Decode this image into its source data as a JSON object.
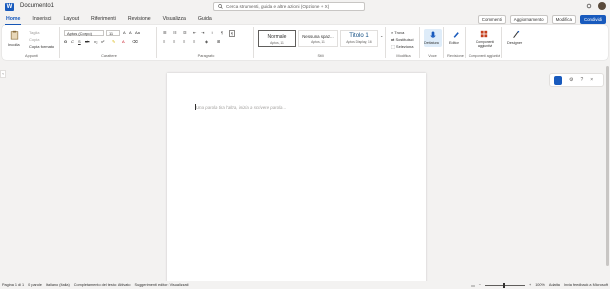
{
  "titlebar": {
    "app_logo_letter": "W",
    "doc_title": "Documento1",
    "search_placeholder": "Cerca strumenti, guida e altre azioni (Opzione + X)"
  },
  "menu": {
    "tabs": [
      "Home",
      "Inserisci",
      "Layout",
      "Riferimenti",
      "Revisione",
      "Visualizza",
      "Guida"
    ],
    "active_tab": "Home",
    "comments_label": "Commenti",
    "updates_label": "Aggiornamento",
    "edit_mode_label": "Modifica",
    "share_label": "Condividi"
  },
  "ribbon": {
    "clipboard": {
      "paste": "Incolla",
      "cut": "Taglia",
      "copy": "Copia",
      "format_painter": "Copia formato",
      "label": "Appunti"
    },
    "font": {
      "family": "Aptos (Corpo)",
      "size": "11",
      "label": "Carattere"
    },
    "paragraph": {
      "label": "Paragrafo"
    },
    "styles": {
      "items": [
        {
          "name": "Normale",
          "sub": "Aptos, 11"
        },
        {
          "name": "Nessuna spaz...",
          "sub": "Aptos, 11"
        },
        {
          "name": "Titolo 1",
          "sub": "Aptos Display, 16"
        }
      ],
      "label": "Stili"
    },
    "editing": {
      "find": "Trova",
      "replace": "Sostituisci",
      "select": "Seleziona",
      "label": "Modifica"
    },
    "voice": {
      "dictate": "Dettatura",
      "label": "Voce"
    },
    "editor": {
      "editor": "Editor",
      "label": "Revisione"
    },
    "addins": {
      "addins": "Componenti aggiuntivi",
      "label": "Componenti aggiuntivi"
    },
    "designer": {
      "designer": "Designer"
    }
  },
  "document": {
    "placeholder": "Una parola tira l'altra, inizia a scrivere parola..."
  },
  "statusbar": {
    "page": "Pagina 1 di 1",
    "words": "0 parole",
    "language": "Italiano (Italia)",
    "autocomplete": "Completamento del testo: Attivato",
    "suggestions": "Suggerimenti editor: Visualizzati",
    "zoom": "100%",
    "fit": "Adatta",
    "feedback": "Invia feedback a Microsoft"
  }
}
